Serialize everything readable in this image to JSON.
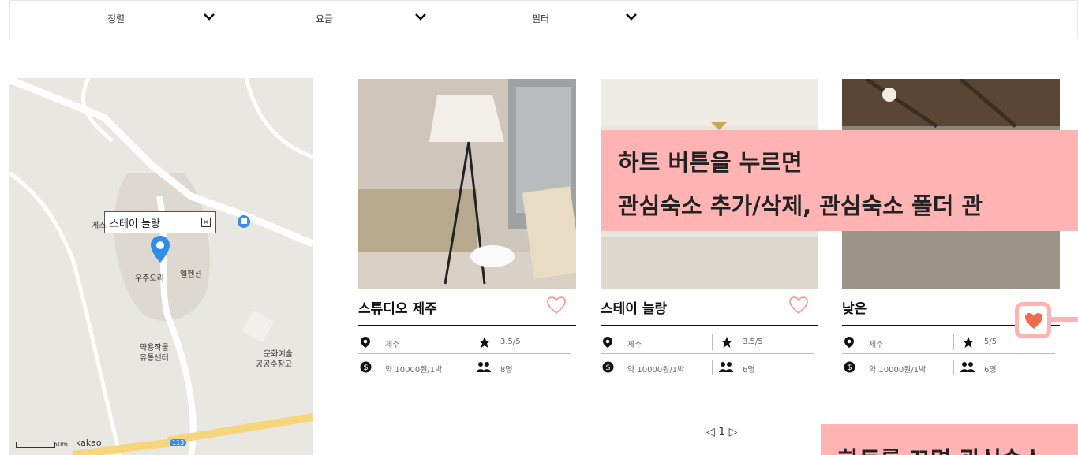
{
  "filters": [
    {
      "label": "정렬"
    },
    {
      "label": "요금"
    },
    {
      "label": "필터"
    }
  ],
  "map": {
    "marker_label": "스테이 늘랑",
    "places": [
      "게스",
      "우주오리",
      "엘펜션",
      "약용작물",
      "유통센터",
      "문화예술",
      "공공수장고"
    ],
    "bus_route": "113",
    "scale": "50m",
    "brand": "kakao"
  },
  "cards": [
    {
      "title": "스튜디오 제주",
      "location": "제주",
      "rating": "3.5/5",
      "price": "약 10000원/1박",
      "capacity": "8명",
      "liked": false
    },
    {
      "title": "스테이 늘랑",
      "location": "제주",
      "rating": "3.5/5",
      "price": "약 10000원/1박",
      "capacity": "6명",
      "liked": false
    },
    {
      "title": "낮은",
      "location": "제주",
      "rating": "5/5",
      "price": "약 10000원/1박",
      "capacity": "6명",
      "liked": true
    }
  ],
  "pagination": {
    "current": "1"
  },
  "annotations": {
    "callout_line1": "하트 버튼을 누르면",
    "callout_line2": "관심숙소 추가/삭제, 관심숙소 폴더 관",
    "callout_bottom": "하트를 끄면 관심숙소"
  },
  "colors": {
    "heart_active": "#f26b4e",
    "heart_inactive": "#f5a08f",
    "callout": "#ffb3b3",
    "marker": "#2f8fe8"
  }
}
